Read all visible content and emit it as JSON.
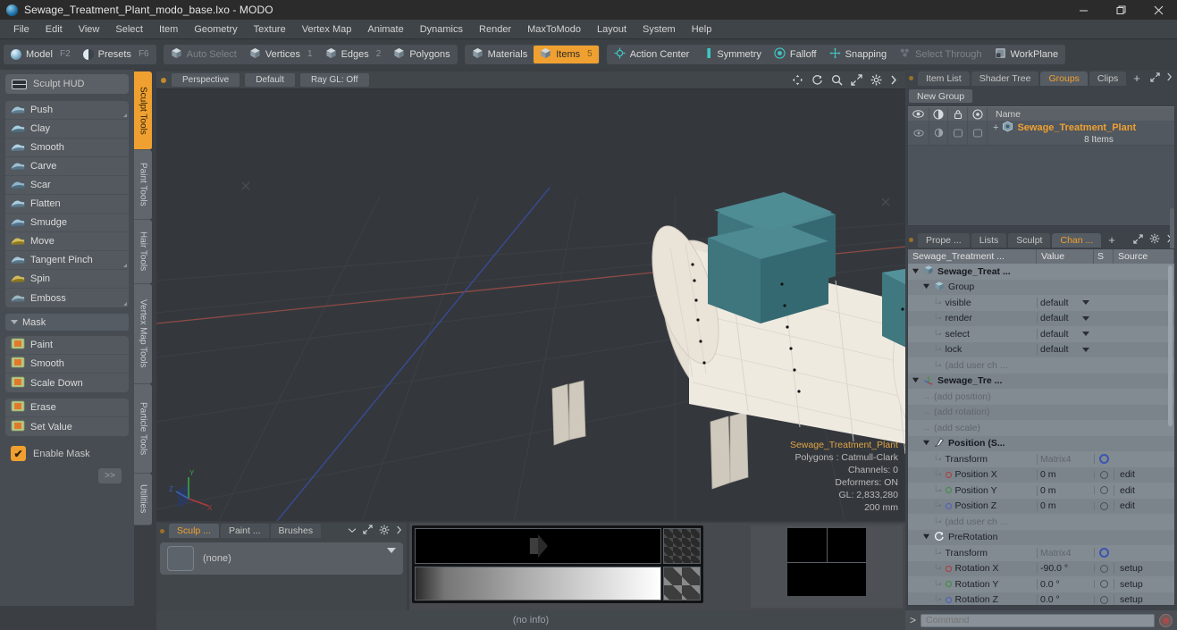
{
  "window": {
    "title": "Sewage_Treatment_Plant_modo_base.lxo - MODO",
    "app_icon": "modo-sphere-icon",
    "controls": {
      "minimize": "—",
      "maximize": "❐",
      "close": "✕"
    }
  },
  "menu": {
    "items": [
      "File",
      "Edit",
      "View",
      "Select",
      "Item",
      "Geometry",
      "Texture",
      "Vertex Map",
      "Animate",
      "Dynamics",
      "Render",
      "MaxToModo",
      "Layout",
      "System",
      "Help"
    ]
  },
  "modebar": {
    "group1": [
      {
        "label": "Model",
        "key": "F2",
        "icon": "sphere-icon",
        "active": false,
        "dim": false
      },
      {
        "label": "Presets",
        "key": "F6",
        "icon": "half-sphere-icon",
        "active": false,
        "dim": false
      }
    ],
    "group2": [
      {
        "label": "Auto Select",
        "key": "",
        "icon": "cube-icon",
        "active": false,
        "dim": true
      },
      {
        "label": "Vertices",
        "key": "1",
        "icon": "cube-icon",
        "active": false,
        "dim": false
      },
      {
        "label": "Edges",
        "key": "2",
        "icon": "cube-icon",
        "active": false,
        "dim": false
      },
      {
        "label": "Polygons",
        "key": "",
        "icon": "cube-icon",
        "active": false,
        "dim": false
      }
    ],
    "group3": [
      {
        "label": "Materials",
        "key": "",
        "icon": "cube-icon",
        "active": false,
        "dim": false
      },
      {
        "label": "Items",
        "key": "5",
        "icon": "cube-icon",
        "active": true,
        "dim": false
      }
    ],
    "group4": [
      {
        "label": "Action Center",
        "key": "",
        "icon": "target-icon",
        "active": false,
        "dim": false
      },
      {
        "label": "Symmetry",
        "key": "",
        "icon": "bars-icon",
        "active": false,
        "dim": false
      },
      {
        "label": "Falloff",
        "key": "",
        "icon": "circle-icon",
        "active": false,
        "dim": false
      },
      {
        "label": "Snapping",
        "key": "",
        "icon": "crosshair-icon",
        "active": false,
        "dim": false
      },
      {
        "label": "Select Through",
        "key": "",
        "icon": "stack-icon",
        "active": false,
        "dim": true
      },
      {
        "label": "WorkPlane",
        "key": "",
        "icon": "plane-icon",
        "active": false,
        "dim": false
      }
    ]
  },
  "left_panel": {
    "hud_label": "Sculpt HUD",
    "sculpt_tools": [
      {
        "label": "Push",
        "icon": "push-brush-icon",
        "corner": true
      },
      {
        "label": "Clay",
        "icon": "clay-brush-icon",
        "corner": false
      },
      {
        "label": "Smooth",
        "icon": "smooth-brush-icon",
        "corner": false
      },
      {
        "label": "Carve",
        "icon": "carve-brush-icon",
        "corner": false
      },
      {
        "label": "Scar",
        "icon": "scar-brush-icon",
        "corner": false
      },
      {
        "label": "Flatten",
        "icon": "flatten-brush-icon",
        "corner": false
      },
      {
        "label": "Smudge",
        "icon": "smudge-brush-icon",
        "corner": false
      },
      {
        "label": "Move",
        "icon": "move-brush-icon",
        "corner": false
      },
      {
        "label": "Tangent Pinch",
        "icon": "pinch-brush-icon",
        "corner": true
      },
      {
        "label": "Spin",
        "icon": "spin-brush-icon",
        "corner": false
      },
      {
        "label": "Emboss",
        "icon": "emboss-brush-icon",
        "corner": true
      }
    ],
    "mask_header": "Mask",
    "mask_tools": [
      {
        "label": "Paint",
        "icon": "mask-paint-icon"
      },
      {
        "label": "Smooth",
        "icon": "mask-smooth-icon"
      },
      {
        "label": "Scale Down",
        "icon": "mask-scale-icon"
      }
    ],
    "mask_tools2": [
      {
        "label": "Erase",
        "icon": "mask-erase-icon"
      },
      {
        "label": "Set Value",
        "icon": "mask-setvalue-icon"
      }
    ],
    "enable_mask": {
      "label": "Enable Mask",
      "checked": true,
      "mark": "✔"
    },
    "more_button": ">>"
  },
  "vertical_tabs": [
    {
      "label": "Sculpt Tools",
      "active": true
    },
    {
      "label": "Paint Tools",
      "active": false
    },
    {
      "label": "Hair Tools",
      "active": false
    },
    {
      "label": "Vertex Map Tools",
      "active": false
    },
    {
      "label": "Particle Tools",
      "active": false
    },
    {
      "label": "Utilities",
      "active": false
    }
  ],
  "viewport": {
    "header": {
      "view_mode": "Perspective",
      "shading": "Default",
      "ray_gl": "Ray GL: Off",
      "icons": [
        "pan-icon",
        "rotate-icon",
        "zoom-icon",
        "fit-icon",
        "gear-icon",
        "chevron-right-icon"
      ]
    },
    "info": {
      "name": "Sewage_Treatment_Plant",
      "polygons": "Polygons : Catmull-Clark",
      "channels": "Channels: 0",
      "deformers": "Deformers: ON",
      "gl": "GL: 2,833,280",
      "scale": "200 mm"
    },
    "axis_gizmo": {
      "x": "X",
      "y": "Y",
      "z": "Z"
    },
    "model_colors": {
      "tank": "#efeae0",
      "roof": "#3d7b85",
      "pipe": "#7a5b4a",
      "background": "#34383d"
    }
  },
  "bottom_panel": {
    "tabs": [
      {
        "label": "Sculp ...",
        "active": true
      },
      {
        "label": "Paint ...",
        "active": false
      },
      {
        "label": "Brushes",
        "active": false
      }
    ],
    "brush_value": "(none)",
    "icons": [
      "expand-icon",
      "gear-icon",
      "chevron-right-icon",
      "chevron-down-icon"
    ]
  },
  "status_bar": {
    "text": "(no info)"
  },
  "right_top": {
    "tabs": [
      {
        "label": "Item List",
        "active": false
      },
      {
        "label": "Shader Tree",
        "active": false
      },
      {
        "label": "Groups",
        "active": true
      },
      {
        "label": "Clips",
        "active": false
      }
    ],
    "plus": "+",
    "icons": [
      "expand-icon",
      "chevron-right-icon"
    ],
    "new_group_button": "New Group",
    "columns": [
      "visible-eye-icon",
      "render-icon",
      "lock-icon",
      "select-icon",
      "Name"
    ],
    "rows": [
      {
        "name": "Sewage_Treatment_Plant",
        "sub": "8 Items",
        "expander": "+",
        "icon": "group-icon"
      }
    ]
  },
  "right_bottom": {
    "tabs": [
      {
        "label": "Prope ...",
        "active": false
      },
      {
        "label": "Lists",
        "active": false
      },
      {
        "label": "Sculpt",
        "active": false
      },
      {
        "label": "Chan ...",
        "active": true
      }
    ],
    "plus": "+",
    "icons": [
      "expand-icon",
      "gear-icon",
      "chevron-right-icon"
    ],
    "columns": [
      "Sewage_Treatment ...",
      "Value",
      "S",
      "Source"
    ],
    "rows": [
      {
        "indent": 0,
        "twisty": "down",
        "icon": "mesh-icon",
        "name": "Sewage_Treat ...",
        "value": "",
        "s": "",
        "source": "",
        "bold": true
      },
      {
        "indent": 1,
        "twisty": "down",
        "icon": "group-icon",
        "name": "Group",
        "value": "",
        "s": "",
        "source": "",
        "bold": false
      },
      {
        "indent": 2,
        "twisty": "leaf",
        "icon": "",
        "name": "visible",
        "value": "default",
        "dropdown": true,
        "s": "",
        "source": ""
      },
      {
        "indent": 2,
        "twisty": "leaf",
        "icon": "",
        "name": "render",
        "value": "default",
        "dropdown": true,
        "s": "",
        "source": ""
      },
      {
        "indent": 2,
        "twisty": "leaf",
        "icon": "",
        "name": "select",
        "value": "default",
        "dropdown": true,
        "s": "",
        "source": ""
      },
      {
        "indent": 2,
        "twisty": "leaf",
        "icon": "",
        "name": "lock",
        "value": "default",
        "dropdown": true,
        "s": "",
        "source": ""
      },
      {
        "indent": 2,
        "twisty": "leaf",
        "icon": "",
        "name": "(add user ch ...",
        "value": "",
        "dim": true,
        "s": "",
        "source": ""
      },
      {
        "indent": 0,
        "twisty": "down",
        "icon": "locator-icon",
        "name": "Sewage_Tre ...",
        "value": "",
        "s": "",
        "source": "",
        "bold": true
      },
      {
        "indent": 1,
        "twisty": "arrow",
        "icon": "",
        "name": "(add position)",
        "value": "",
        "dim": true,
        "s": "",
        "source": ""
      },
      {
        "indent": 1,
        "twisty": "arrow",
        "icon": "",
        "name": "(add rotation)",
        "value": "",
        "dim": true,
        "s": "",
        "source": ""
      },
      {
        "indent": 1,
        "twisty": "arrow",
        "icon": "",
        "name": "(add scale)",
        "value": "",
        "dim": true,
        "s": "",
        "source": ""
      },
      {
        "indent": 1,
        "twisty": "down",
        "icon": "position-icon",
        "name": "Position (S...",
        "value": "",
        "s": "",
        "source": "",
        "bold": true
      },
      {
        "indent": 2,
        "twisty": "leaf",
        "icon": "",
        "name": "Transform",
        "value": "Matrix4",
        "valdim": true,
        "s": "gear",
        "source": ""
      },
      {
        "indent": 2,
        "twisty": "leaf",
        "icon": "dot-x",
        "name": "Position X",
        "value": "0 m",
        "s": "circle",
        "source": "edit"
      },
      {
        "indent": 2,
        "twisty": "leaf",
        "icon": "dot-y",
        "name": "Position Y",
        "value": "0 m",
        "s": "circle",
        "source": "edit"
      },
      {
        "indent": 2,
        "twisty": "leaf",
        "icon": "dot-z",
        "name": "Position Z",
        "value": "0 m",
        "s": "circle",
        "source": "edit"
      },
      {
        "indent": 2,
        "twisty": "leaf",
        "icon": "",
        "name": "(add user ch ...",
        "value": "",
        "dim": true,
        "s": "",
        "source": ""
      },
      {
        "indent": 1,
        "twisty": "down",
        "icon": "prerotation-icon",
        "name": "PreRotation",
        "value": "",
        "s": "",
        "source": "",
        "bold": false
      },
      {
        "indent": 2,
        "twisty": "leaf",
        "icon": "",
        "name": "Transform",
        "value": "Matrix4",
        "valdim": true,
        "s": "gear",
        "source": ""
      },
      {
        "indent": 2,
        "twisty": "leaf",
        "icon": "dot-x",
        "name": "Rotation X",
        "value": "-90.0 °",
        "s": "circle",
        "source": "setup"
      },
      {
        "indent": 2,
        "twisty": "leaf",
        "icon": "dot-y",
        "name": "Rotation Y",
        "value": "0.0 °",
        "s": "circle",
        "source": "setup"
      },
      {
        "indent": 2,
        "twisty": "leaf",
        "icon": "dot-z",
        "name": "Rotation Z",
        "value": "0.0 °",
        "s": "circle",
        "source": "setup"
      }
    ]
  },
  "command_bar": {
    "prompt": ">",
    "placeholder": "Command",
    "value": "",
    "record_icon": "record-icon"
  },
  "theme": {
    "accent": "#f0a030",
    "panel": "#474c52",
    "viewport_bg": "#34383d",
    "titlebar": "#2b2b2b"
  }
}
